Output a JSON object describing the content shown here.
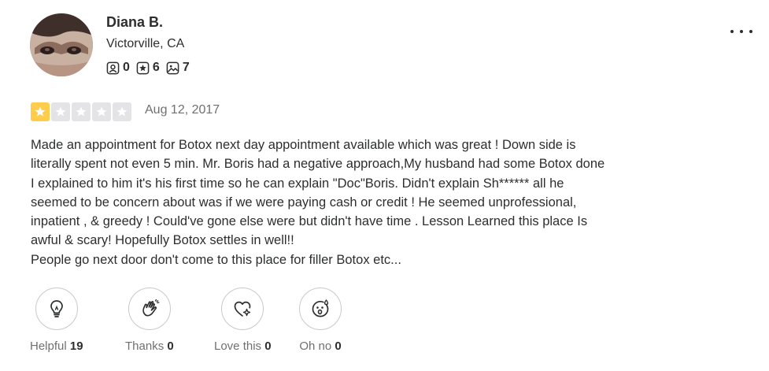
{
  "user": {
    "name": "Diana B.",
    "location": "Victorville, CA",
    "stats": {
      "friends": "0",
      "reviews": "6",
      "photos": "7"
    }
  },
  "review": {
    "rating": 1,
    "rating_max": 5,
    "date": "Aug 12, 2017",
    "text": "Made an appointment for Botox next day appointment available which was great ! Down side is\nliterally spent not even 5 min. Mr. Boris had a negative approach,My husband had some Botox done\nI explained to him it's his first time so he can explain \"Doc\"Boris. Didn't explain Sh****** all he\nseemed to be concern about was if we were paying cash or credit ! He seemed unprofessional,\ninpatient , & greedy ! Could've gone else were but didn't have time . Lesson Learned this place Is\nawful & scary! Hopefully Botox settles in well!!\nPeople go next door don't come to this place for filler Botox etc..."
  },
  "reactions": [
    {
      "label": "Helpful",
      "count": "19",
      "icon": "lightbulb-icon"
    },
    {
      "label": "Thanks",
      "count": "0",
      "icon": "clapping-hands-icon"
    },
    {
      "label": "Love this",
      "count": "0",
      "icon": "heart-sparkle-icon"
    },
    {
      "label": "Oh no",
      "count": "0",
      "icon": "surprised-face-icon"
    }
  ],
  "colors": {
    "star_filled": "#ffcc4b",
    "star_empty": "#e4e4e7",
    "text": "#2d2e2f",
    "muted": "#6e7072"
  }
}
